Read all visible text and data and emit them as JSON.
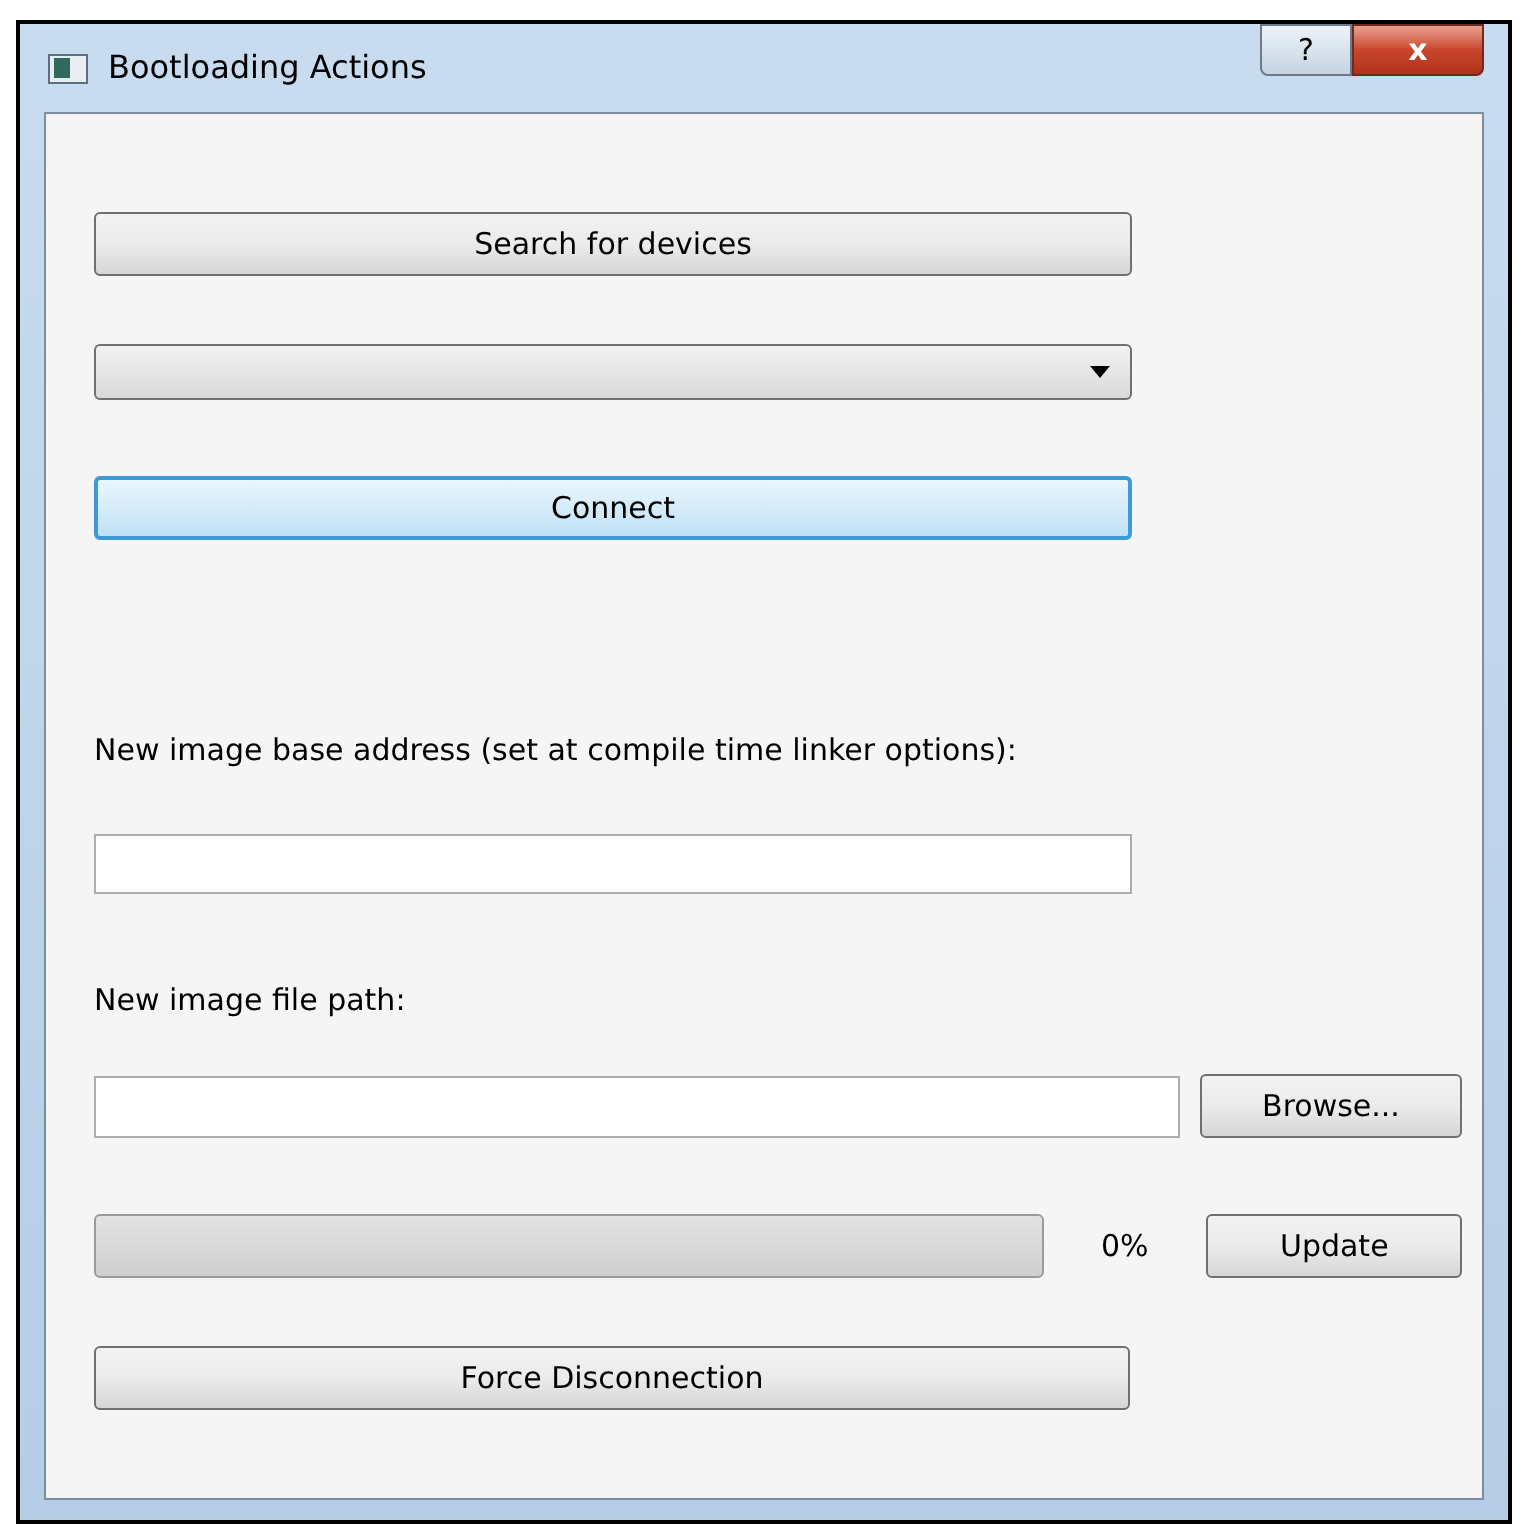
{
  "window": {
    "title": "Bootloading Actions",
    "help_button": "?",
    "close_button": "x"
  },
  "search_button": "Search for devices",
  "connect_button": {
    "label": "Connect",
    "focused": true
  },
  "base_address": {
    "label": "New image base address (set at compile time linker options):"
  },
  "file_path": {
    "label": "New image file path:",
    "browse_button": "Browse..."
  },
  "progress": {
    "level": 0,
    "reading": "0%",
    "update_button": "Update"
  },
  "disconnect_button": "Force Disconnection"
}
